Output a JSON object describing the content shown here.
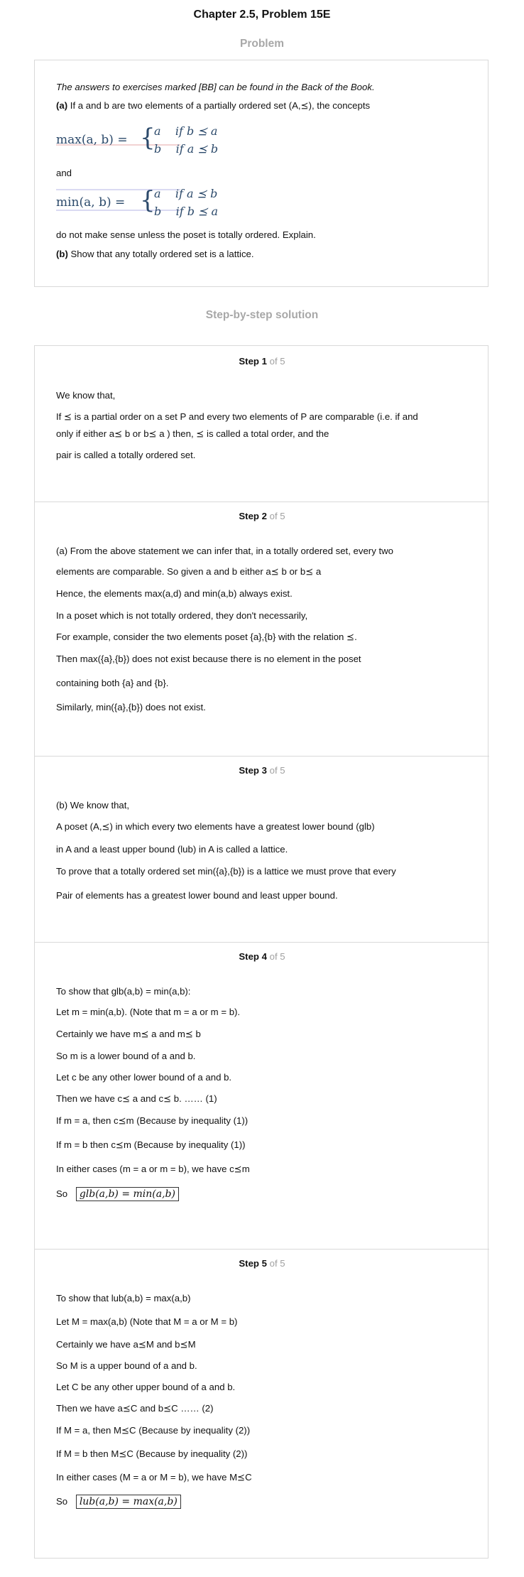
{
  "header": {
    "title": "Chapter 2.5, Problem 15E"
  },
  "problem": {
    "label": "Problem",
    "intro": "The answers to exercises marked [BB] can be found in the Back of the Book.",
    "part_a_label": "(a)",
    "part_a_text": "If a and b are two elements of a partially ordered set (A,⪯), the concepts",
    "max_lhs": "max(a, b) =",
    "max_case1": "a    if b ⪯ a",
    "max_case2": "b    if a ⪯ b",
    "and": "and",
    "min_lhs": "min(a, b) =",
    "min_case1": "a    if a ⪯ b",
    "min_case2": "b    if b ⪯ a",
    "after": "do not make sense unless the poset is totally ordered. Explain.",
    "part_b_label": "(b)",
    "part_b_text": "Show that any totally ordered set is a lattice."
  },
  "solution": {
    "label": "Step-by-step solution"
  },
  "steps": [
    {
      "title": "Step 1",
      "of": "of 5",
      "lines": [
        "We know that,",
        "If ⪯ is a partial order on a set P and every two elements of P are comparable (i.e. if and",
        "only if either a⪯ b or b⪯ a ) then, ⪯ is called a total order, and the",
        "pair is called a totally ordered set."
      ]
    },
    {
      "title": "Step 2",
      "of": "of 5",
      "lines": [
        "(a) From the above statement we can infer that, in a totally ordered set, every two",
        "elements are comparable. So given a and b either a⪯ b or b⪯ a",
        "Hence, the elements max(a,d) and min(a,b) always exist.",
        "In a poset which is not totally ordered, they don't necessarily,",
        "For example, consider the two elements poset {a},{b} with the relation ⪯.",
        "Then max({a},{b}) does not exist because there is no element in the poset",
        "containing both {a} and {b}.",
        "Similarly, min({a},{b}) does not exist."
      ]
    },
    {
      "title": "Step 3",
      "of": "of 5",
      "lines": [
        "(b) We know that,",
        "A poset (A,⪯) in which every two elements have a greatest lower bound (glb)",
        "in A and a least upper bound (lub) in A is called a lattice.",
        "To prove that a totally ordered set min({a},{b}) is a lattice we must prove that every",
        "Pair of elements has a greatest lower bound and least upper bound."
      ]
    },
    {
      "title": "Step 4",
      "of": "of 5",
      "lines": [
        "To show that glb(a,b) = min(a,b):",
        "Let m = min(a,b). (Note that m = a or m = b).",
        "Certainly we have m⪯ a and m⪯ b",
        "So m is a lower bound of a and b.",
        "Let c be any other lower bound of a and b.",
        "Then we have c⪯ a and c⪯ b. …… (1)",
        "If m = a, then c⪯m (Because by inequality (1))",
        "If m = b then c⪯m (Because by inequality (1))",
        "In either cases (m = a or m = b), we have c⪯m",
        "So"
      ],
      "boxed": "glb(a,b) = min(a,b)"
    },
    {
      "title": "Step 5",
      "of": "of 5",
      "lines": [
        "To show that lub(a,b) = max(a,b)",
        "Let M = max(a,b)   (Note that M = a or M = b)",
        "Certainly we have a⪯M and b⪯M",
        "So M is a upper bound of a and b.",
        "Let C be any other upper bound of a and b.",
        "Then we have a⪯C and b⪯C …… (2)",
        "If M = a, then M⪯C (Because by inequality (2))",
        "If M = b then M⪯C (Because by inequality (2))",
        "In either cases (M = a or M = b), we have M⪯C",
        "So"
      ],
      "boxed": "lub(a,b) = max(a,b)"
    }
  ]
}
